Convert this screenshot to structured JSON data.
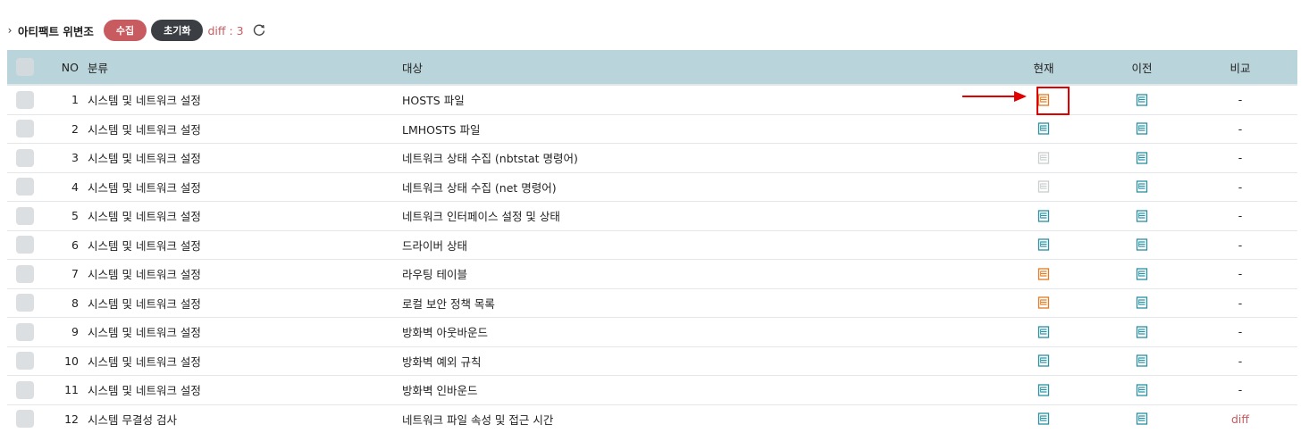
{
  "header": {
    "title": "아티팩트 위변조",
    "collect_label": "수집",
    "reset_label": "초기화",
    "diff_label": "diff : 3"
  },
  "columns": {
    "no": "NO",
    "category": "분류",
    "target": "대상",
    "current": "현재",
    "previous": "이전",
    "compare": "비교"
  },
  "colors": {
    "doc_teal": "#2a8fa0",
    "doc_orange": "#e07b26",
    "doc_gray": "#c9cdd0",
    "accent_red": "#c85b5f",
    "highlight": "#e00000"
  },
  "rows": [
    {
      "no": "1",
      "category": "시스템 및 네트워크 설정",
      "target": "HOSTS 파일",
      "current": "orange",
      "previous": "teal",
      "compare": "-"
    },
    {
      "no": "2",
      "category": "시스템 및 네트워크 설정",
      "target": "LMHOSTS 파일",
      "current": "teal",
      "previous": "teal",
      "compare": "-"
    },
    {
      "no": "3",
      "category": "시스템 및 네트워크 설정",
      "target": "네트워크 상태 수집 (nbtstat 명령어)",
      "current": "gray",
      "previous": "teal",
      "compare": "-"
    },
    {
      "no": "4",
      "category": "시스템 및 네트워크 설정",
      "target": "네트워크 상태 수집 (net 명령어)",
      "current": "gray",
      "previous": "teal",
      "compare": "-"
    },
    {
      "no": "5",
      "category": "시스템 및 네트워크 설정",
      "target": "네트워크 인터페이스 설정 및 상태",
      "current": "teal",
      "previous": "teal",
      "compare": "-"
    },
    {
      "no": "6",
      "category": "시스템 및 네트워크 설정",
      "target": "드라이버 상태",
      "current": "teal",
      "previous": "teal",
      "compare": "-"
    },
    {
      "no": "7",
      "category": "시스템 및 네트워크 설정",
      "target": "라우팅 테이블",
      "current": "orange",
      "previous": "teal",
      "compare": "-"
    },
    {
      "no": "8",
      "category": "시스템 및 네트워크 설정",
      "target": "로컬 보안 정책 목록",
      "current": "orange",
      "previous": "teal",
      "compare": "-"
    },
    {
      "no": "9",
      "category": "시스템 및 네트워크 설정",
      "target": "방화벽 아웃바운드",
      "current": "teal",
      "previous": "teal",
      "compare": "-"
    },
    {
      "no": "10",
      "category": "시스템 및 네트워크 설정",
      "target": "방화벽 예외 규칙",
      "current": "teal",
      "previous": "teal",
      "compare": "-"
    },
    {
      "no": "11",
      "category": "시스템 및 네트워크 설정",
      "target": "방화벽 인바운드",
      "current": "teal",
      "previous": "teal",
      "compare": "-"
    },
    {
      "no": "12",
      "category": "시스템 무결성 검사",
      "target": "네트워크 파일 속성 및 접근 시간",
      "current": "teal",
      "previous": "teal",
      "compare": "diff"
    }
  ]
}
